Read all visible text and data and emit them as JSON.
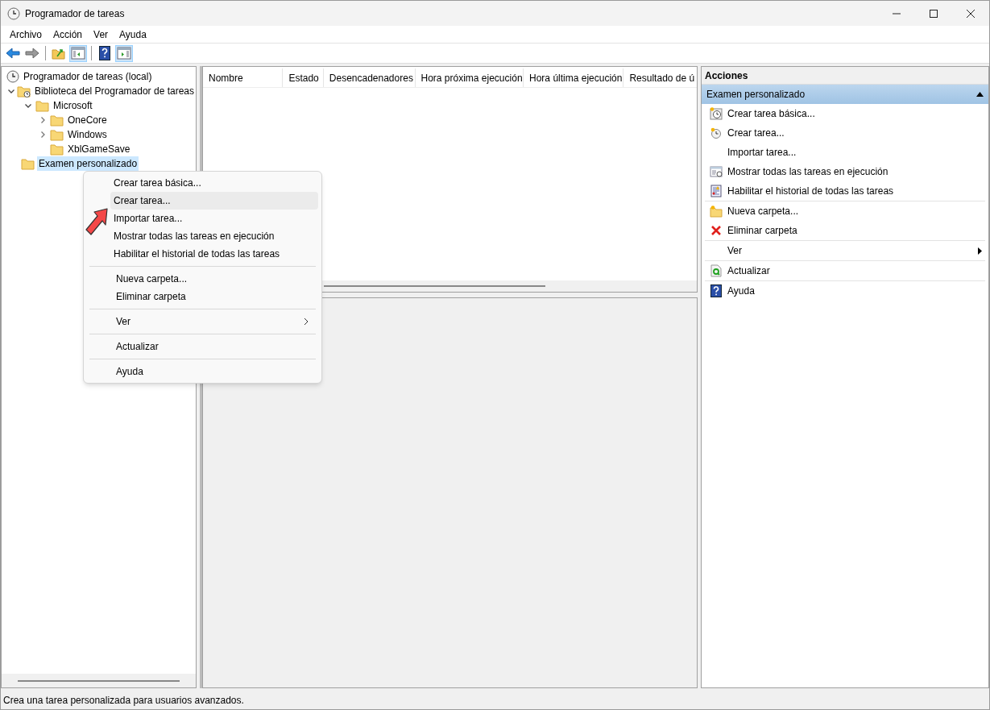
{
  "window": {
    "title": "Programador de tareas"
  },
  "menu_bar": [
    "Archivo",
    "Acción",
    "Ver",
    "Ayuda"
  ],
  "toolbar": [
    [
      {
        "kind": "back",
        "pressed": false
      },
      {
        "kind": "forward",
        "pressed": false
      }
    ],
    [
      {
        "kind": "up",
        "pressed": false
      },
      {
        "kind": "tree-pane",
        "pressed": true
      }
    ],
    [
      {
        "kind": "help",
        "pressed": false
      },
      {
        "kind": "action-pane",
        "pressed": true
      }
    ]
  ],
  "tree": [
    {
      "label": "Programador de tareas (local)",
      "kind": "clock",
      "selected": false,
      "children": [
        {
          "label": "Biblioteca del Programador de tareas",
          "kind": "library",
          "expanded": true,
          "selected": false,
          "children": [
            {
              "label": "Microsoft",
              "kind": "folder",
              "expanded": true,
              "selected": false,
              "children": [
                {
                  "label": "OneCore",
                  "kind": "folder",
                  "expanded": false,
                  "selected": false
                },
                {
                  "label": "Windows",
                  "kind": "folder",
                  "expanded": false,
                  "selected": false
                },
                {
                  "label": "XblGameSave",
                  "kind": "folder",
                  "selected": false
                }
              ]
            }
          ]
        },
        {
          "label": "Examen personalizado",
          "kind": "folder",
          "selected": true
        }
      ]
    }
  ],
  "table": {
    "columns": [
      "Nombre",
      "Estado",
      "Desencadenadores",
      "Hora próxima ejecución",
      "Hora última ejecución",
      "Resultado de ú"
    ]
  },
  "actions": {
    "title": "Acciones",
    "section": {
      "label": "Examen personalizado",
      "expanded": true
    },
    "groups": [
      [
        {
          "label": "Crear tarea básica...",
          "kind": "command"
        },
        {
          "label": "Crear tarea...",
          "kind": "command"
        },
        {
          "label": "Importar tarea...",
          "kind": "command"
        },
        {
          "label": "Mostrar todas las tareas en ejecución",
          "kind": "command"
        },
        {
          "label": "Habilitar el historial de todas las tareas",
          "kind": "command"
        }
      ],
      [
        {
          "label": "Nueva carpeta...",
          "kind": "command"
        },
        {
          "label": "Eliminar carpeta",
          "kind": "command"
        }
      ],
      [
        {
          "label": "Ver",
          "kind": "submenu"
        }
      ],
      [
        {
          "label": "Actualizar",
          "kind": "command"
        }
      ],
      [
        {
          "label": "Ayuda",
          "kind": "command"
        }
      ]
    ]
  },
  "context_menu": {
    "groups": [
      [
        {
          "label": "Crear tarea básica...",
          "kind": "command",
          "selected": false
        },
        {
          "label": "Crear tarea...",
          "kind": "command",
          "selected": true
        },
        {
          "label": "Importar tarea...",
          "kind": "command",
          "selected": false
        },
        {
          "label": "Mostrar todas las tareas en ejecución",
          "kind": "command",
          "selected": false
        },
        {
          "label": "Habilitar el historial de todas las tareas",
          "kind": "command",
          "selected": false
        }
      ],
      [
        {
          "label": "Nueva carpeta...",
          "kind": "command",
          "selected": false
        },
        {
          "label": "Eliminar carpeta",
          "kind": "command",
          "selected": false
        }
      ],
      [
        {
          "label": "Ver",
          "kind": "submenu",
          "selected": false
        }
      ],
      [
        {
          "label": "Actualizar",
          "kind": "command",
          "selected": false
        }
      ],
      [
        {
          "label": "Ayuda",
          "kind": "command",
          "selected": false
        }
      ]
    ]
  },
  "status_bar": "Crea una tarea personalizada para usuarios avanzados."
}
